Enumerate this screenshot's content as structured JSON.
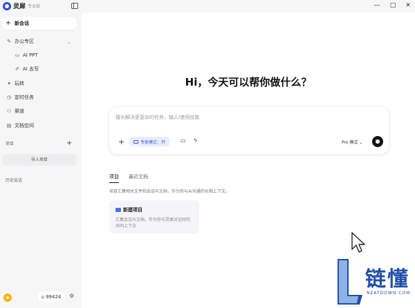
{
  "window": {
    "app_name": "灵犀",
    "app_tag": "专业版",
    "minimize": "—",
    "maximize": "□",
    "close": "✕"
  },
  "sidebar": {
    "new_chat": "新会话",
    "office_group": "办公专区",
    "ai_ppt": "AI PPT",
    "ai_write": "AI 去写",
    "apps": "玩转",
    "scheduled": "定时任务",
    "channels": "渠道",
    "files": "文档空间",
    "projects_label": "项目",
    "import_project": "导入项目",
    "history_label": "历史会话",
    "points": "99424"
  },
  "main": {
    "headline": "Hi，今天可以帮你做什么？",
    "composer_placeholder": "擅长解决更复杂的任务，输入/使用技能",
    "expert_mode": "专家模式：开",
    "model": "Pro 模式 ⌄",
    "tabs": [
      "项目",
      "最近文档"
    ],
    "tab_desc": "项目汇集相关文件和会话与文档，作为你与AI沟通的长期上下文。",
    "card_title": "新建项目",
    "card_desc": "汇集会话与文档，作为你与灵犀对话时的共同上下文"
  },
  "watermark": {
    "text": "链懂",
    "sub": "NEATDOWN.COM"
  },
  "colors": {
    "accent": "#3b5bdb",
    "logo_blue": "#2b4dd6",
    "avatar": "#f4b400"
  }
}
